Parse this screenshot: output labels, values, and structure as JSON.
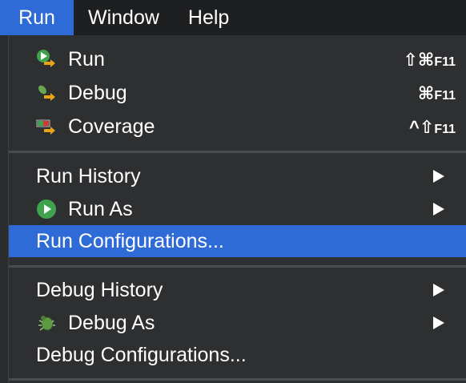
{
  "menubar": {
    "items": [
      {
        "label": "Run",
        "active": true
      },
      {
        "label": "Window",
        "active": false
      },
      {
        "label": "Help",
        "active": false
      }
    ]
  },
  "menu": {
    "run": {
      "label": "Run",
      "shortcut_symbols": "⇧⌘",
      "shortcut_key": "F11",
      "icon": "run-icon"
    },
    "debug": {
      "label": "Debug",
      "shortcut_symbols": "⌘",
      "shortcut_key": "F11",
      "icon": "debug-icon"
    },
    "coverage": {
      "label": "Coverage",
      "shortcut_symbols": "^⇧",
      "shortcut_key": "F11",
      "icon": "coverage-icon"
    },
    "run_history": {
      "label": "Run History"
    },
    "run_as": {
      "label": "Run As",
      "icon": "run-as-icon"
    },
    "run_configurations": {
      "label": "Run Configurations..."
    },
    "debug_history": {
      "label": "Debug History"
    },
    "debug_as": {
      "label": "Debug As",
      "icon": "bug-icon"
    },
    "debug_configurations": {
      "label": "Debug Configurations..."
    }
  },
  "colors": {
    "accent": "#2f6bd6",
    "menu_bg": "#2e2f31",
    "menubar_bg": "#1e1f21",
    "text": "#ffffff"
  }
}
